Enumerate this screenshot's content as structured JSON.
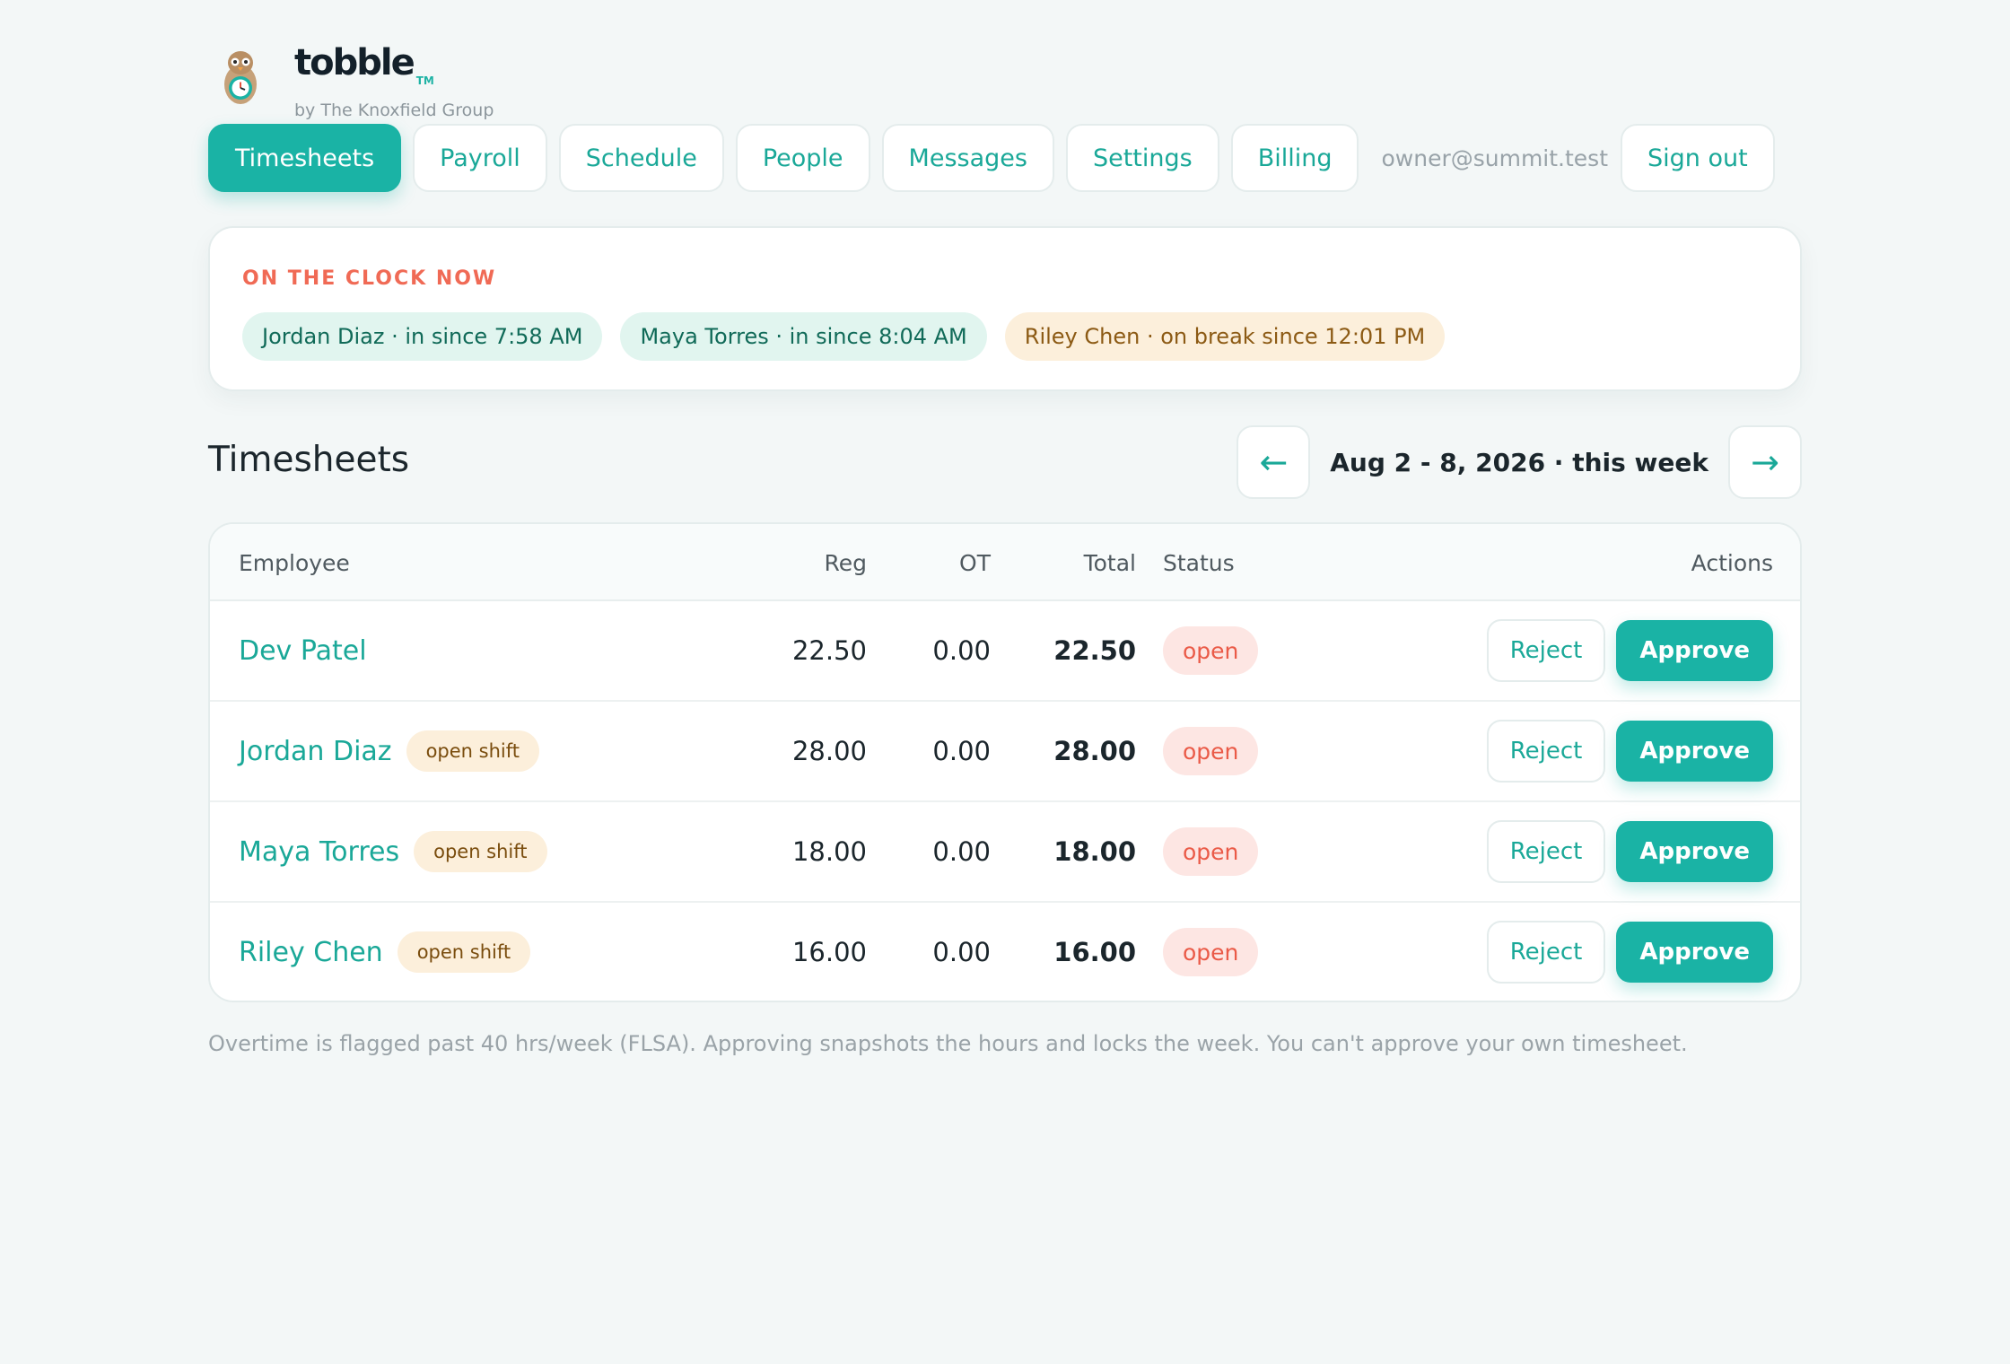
{
  "brand": {
    "name": "tobble",
    "trademark": "TM",
    "byline": "by The Knoxfield Group"
  },
  "nav": {
    "items": [
      {
        "label": "Timesheets",
        "active": true
      },
      {
        "label": "Payroll",
        "active": false
      },
      {
        "label": "Schedule",
        "active": false
      },
      {
        "label": "People",
        "active": false
      },
      {
        "label": "Messages",
        "active": false
      },
      {
        "label": "Settings",
        "active": false
      },
      {
        "label": "Billing",
        "active": false
      }
    ],
    "user_email": "owner@summit.test",
    "sign_out": "Sign out"
  },
  "on_clock": {
    "title": "ON THE CLOCK NOW",
    "entries": [
      {
        "text": "Jordan Diaz · in since 7:58 AM",
        "state": "in"
      },
      {
        "text": "Maya Torres · in since 8:04 AM",
        "state": "in"
      },
      {
        "text": "Riley Chen · on break since 12:01 PM",
        "state": "break"
      }
    ]
  },
  "timesheets": {
    "title": "Timesheets",
    "week_label": "Aug 2 - 8, 2026 · this week",
    "prev_icon": "←",
    "next_icon": "→",
    "columns": {
      "employee": "Employee",
      "reg": "Reg",
      "ot": "OT",
      "total": "Total",
      "status": "Status",
      "actions": "Actions"
    },
    "rows": [
      {
        "name": "Dev Patel",
        "badge": "",
        "reg": "22.50",
        "ot": "0.00",
        "total": "22.50",
        "status": "open"
      },
      {
        "name": "Jordan Diaz",
        "badge": "open shift",
        "reg": "28.00",
        "ot": "0.00",
        "total": "28.00",
        "status": "open"
      },
      {
        "name": "Maya Torres",
        "badge": "open shift",
        "reg": "18.00",
        "ot": "0.00",
        "total": "18.00",
        "status": "open"
      },
      {
        "name": "Riley Chen",
        "badge": "open shift",
        "reg": "16.00",
        "ot": "0.00",
        "total": "16.00",
        "status": "open"
      }
    ],
    "reject_label": "Reject",
    "approve_label": "Approve"
  },
  "footnote": "Overtime is flagged past 40 hrs/week (FLSA). Approving snapshots the hours and locks the week. You can't approve your own timesheet.",
  "colors": {
    "accent": "#1ab3a5",
    "alert": "#f06a55",
    "background": "#f3f7f7"
  }
}
